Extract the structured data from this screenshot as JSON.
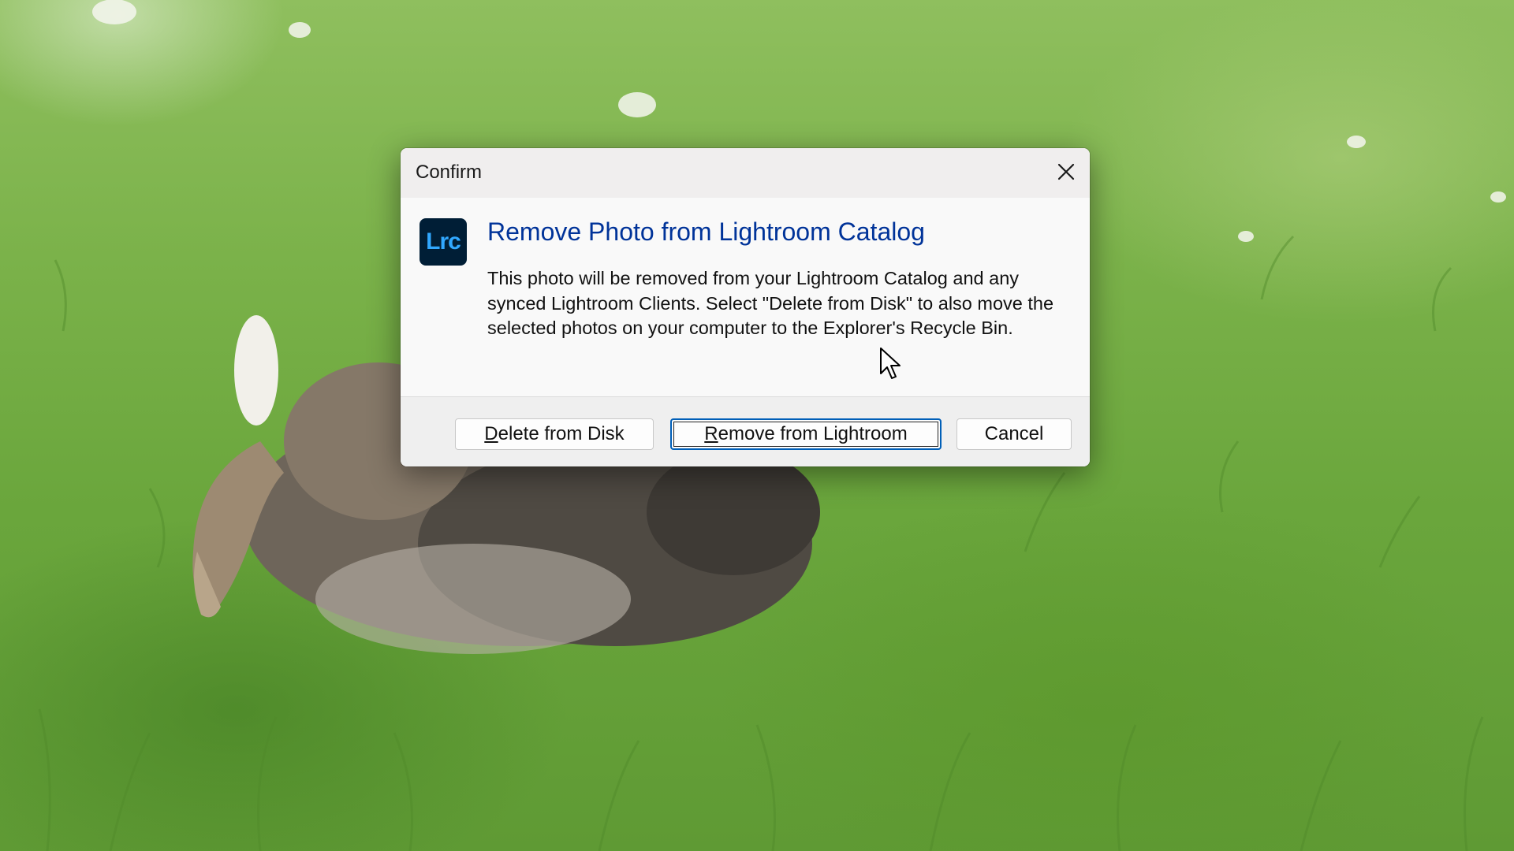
{
  "dialog": {
    "title": "Confirm",
    "app_icon_text": "Lrc",
    "heading": "Remove Photo from Lightroom Catalog",
    "message": "This photo will be removed from your Lightroom Catalog and any synced Lightroom Clients. Select \"Delete from Disk\" to also move the selected photos on your computer to the Explorer's Recycle Bin.",
    "buttons": {
      "delete": {
        "accel": "D",
        "rest": "elete from Disk"
      },
      "remove": {
        "accel": "R",
        "rest": "emove from Lightroom"
      },
      "cancel": "Cancel"
    },
    "icons": {
      "close": "close-icon",
      "app": "lightroom-classic-icon"
    }
  },
  "colors": {
    "heading": "#003399",
    "default_button_border": "#005fb8",
    "app_icon_bg": "#001e36",
    "app_icon_fg": "#31a8ff"
  }
}
